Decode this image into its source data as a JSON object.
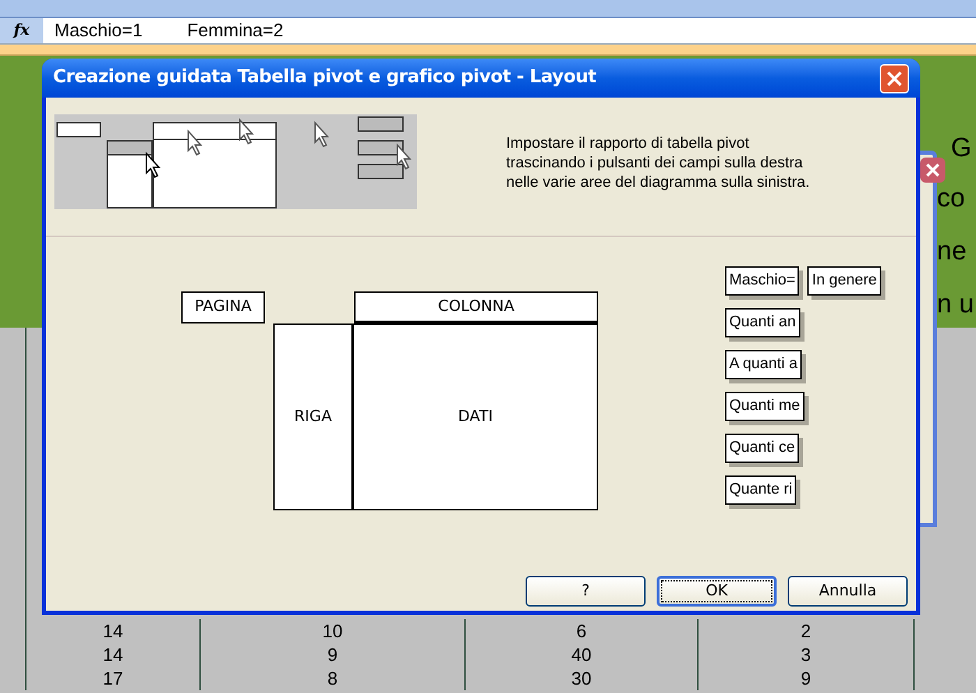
{
  "formula_bar": {
    "function_label": "fx",
    "content": [
      "Maschio=1",
      "Femmina=2"
    ]
  },
  "background_text": [
    "G",
    "co",
    "ne",
    "n u"
  ],
  "sheet_rows": [
    [
      "14",
      "10",
      "6",
      "2"
    ],
    [
      "14",
      "9",
      "40",
      "3"
    ],
    [
      "17",
      "8",
      "30",
      "9"
    ]
  ],
  "dialog": {
    "title": "Creazione guidata Tabella pivot e grafico pivot - Layout",
    "instructions": "Impostare il rapporto di tabella pivot trascinando i pulsanti dei campi sulla destra nelle varie aree del diagramma sulla sinistra.",
    "areas": {
      "page": "PAGINA",
      "column": "COLONNA",
      "row": "RIGA",
      "data": "DATI"
    },
    "fields": [
      [
        "Maschio=",
        "In genere"
      ],
      [
        "Quanti an"
      ],
      [
        "A quanti a"
      ],
      [
        "Quanti me"
      ],
      [
        "Quanti ce"
      ],
      [
        "Quante ri"
      ]
    ],
    "buttons": [
      {
        "label": "?",
        "default": false
      },
      {
        "label": "OK",
        "default": true
      },
      {
        "label": "Annulla",
        "default": false
      }
    ]
  }
}
